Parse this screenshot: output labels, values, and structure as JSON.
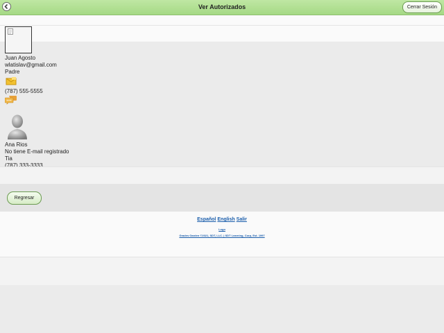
{
  "header": {
    "title": "Ver Autorizados",
    "logout_label": "Cerrar Sesión"
  },
  "contacts": [
    {
      "name": "Juan Agosto",
      "email": "wlatislav@gmail.com",
      "relation": "Padre",
      "phone": "(787) 555-5555"
    },
    {
      "name": "Ana Rios",
      "email": "No tiene E-mail registrado",
      "relation": "Tia",
      "phone": "(787) 333-3333"
    }
  ],
  "back_label": "Regresar",
  "footer": {
    "lang_es": "Español",
    "lang_en": "English",
    "exit": "Salir",
    "small_link": "Logo",
    "copyright": "Grades Garden ©2021, SDT, LLC. | SDT Learning, Corp, Est. 1997"
  },
  "colors": {
    "header_green": "#a5d985",
    "link_blue": "#1a5dab",
    "background": "#ebebeb"
  }
}
